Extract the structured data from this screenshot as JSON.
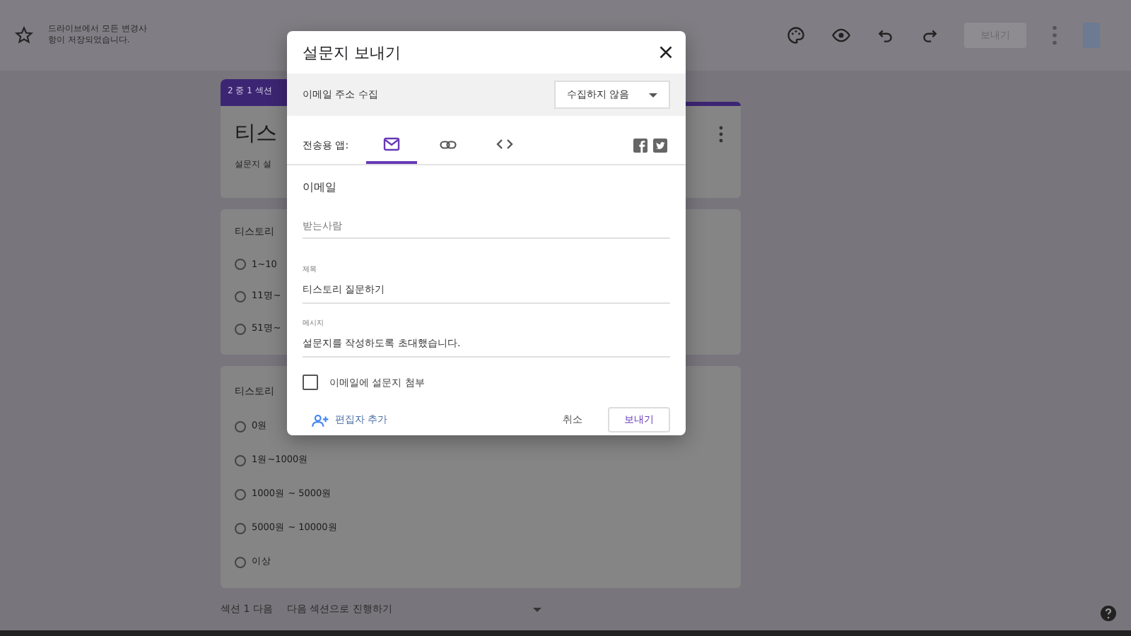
{
  "top_bar": {
    "save_status": "드라이브에서 모든 변경사항이 저장되었습니다.",
    "send_button": "보내기"
  },
  "form": {
    "section_tab": "2 중 1 섹션",
    "title": "티스",
    "description": "설문지 설",
    "questions": [
      {
        "title": "티스토리",
        "options": [
          {
            "label": "1~10",
            "selected": false
          },
          {
            "label": "11명~",
            "selected": false
          },
          {
            "label": "51명~",
            "selected": false
          }
        ]
      },
      {
        "title": "티스토리",
        "options": [
          {
            "label": "0원",
            "selected": false
          },
          {
            "label": "1원~1000원",
            "selected": false
          },
          {
            "label": "1000원 ~ 5000원",
            "selected": false
          },
          {
            "label": "5000원 ~ 10000원",
            "selected": false
          },
          {
            "label": "이상",
            "selected": false
          }
        ]
      }
    ],
    "after_section_label": "섹션 1 다음",
    "after_section_value": "다음 섹션으로 진행하기"
  },
  "dialog": {
    "title": "설문지 보내기",
    "collect_label": "이메일 주소 수집",
    "collect_value": "수집하지 않음",
    "send_via_label": "전송용 앱:",
    "tabs": [
      {
        "kind": "email",
        "selected": true
      },
      {
        "kind": "link",
        "selected": false
      },
      {
        "kind": "embed",
        "selected": false
      }
    ],
    "section_title": "이메일",
    "to_placeholder": "받는사람",
    "subject_label": "제목",
    "subject_value": "티스토리 질문하기",
    "message_label": "메시지",
    "message_value": "설문지를 작성하도록 초대했습니다.",
    "attach": {
      "label": "이메일에 설문지 첨부",
      "checked": false
    },
    "add_editor": "편집자 추가",
    "cancel": "취소",
    "send": "보내기"
  }
}
